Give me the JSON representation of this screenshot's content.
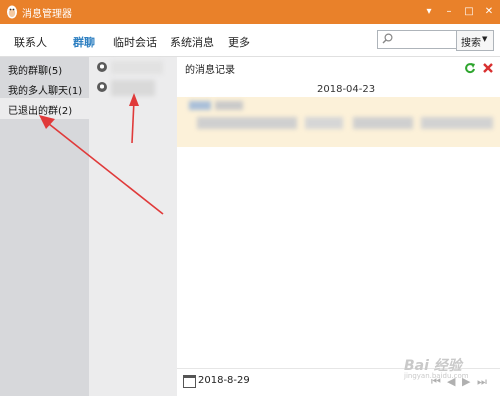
{
  "window": {
    "title": "消息管理器",
    "controls": [
      "▾",
      "–",
      "□",
      "✕"
    ]
  },
  "tabs": [
    "联系人",
    "群聊",
    "临时会话",
    "系统消息",
    "更多"
  ],
  "search": {
    "placeholder": "",
    "button_label": "搜索"
  },
  "categories": [
    "我的群聊(5)",
    "我的多人聊天(1)",
    "已退出的群(2)"
  ],
  "group_list_icons": [
    "group-icon",
    "group-icon"
  ],
  "record": {
    "title_suffix": "的消息记录",
    "date_separator": "2018-04-23",
    "footer_date": "2018-8-29"
  },
  "toolbar_icons": [
    "refresh-icon",
    "delete-icon"
  ],
  "nav_icons": [
    "first-page-icon",
    "prev-page-icon",
    "next-page-icon",
    "last-page-icon"
  ],
  "watermark": {
    "main": "Bai 经验",
    "sub": "jingyan.baidu.com"
  },
  "colors": {
    "titlebar": "#e9812a",
    "active_tab": "#2d7fc1",
    "sidebar": "#d7d8db",
    "highlight": "#fcf1d9",
    "arrow": "#e03a3a"
  }
}
